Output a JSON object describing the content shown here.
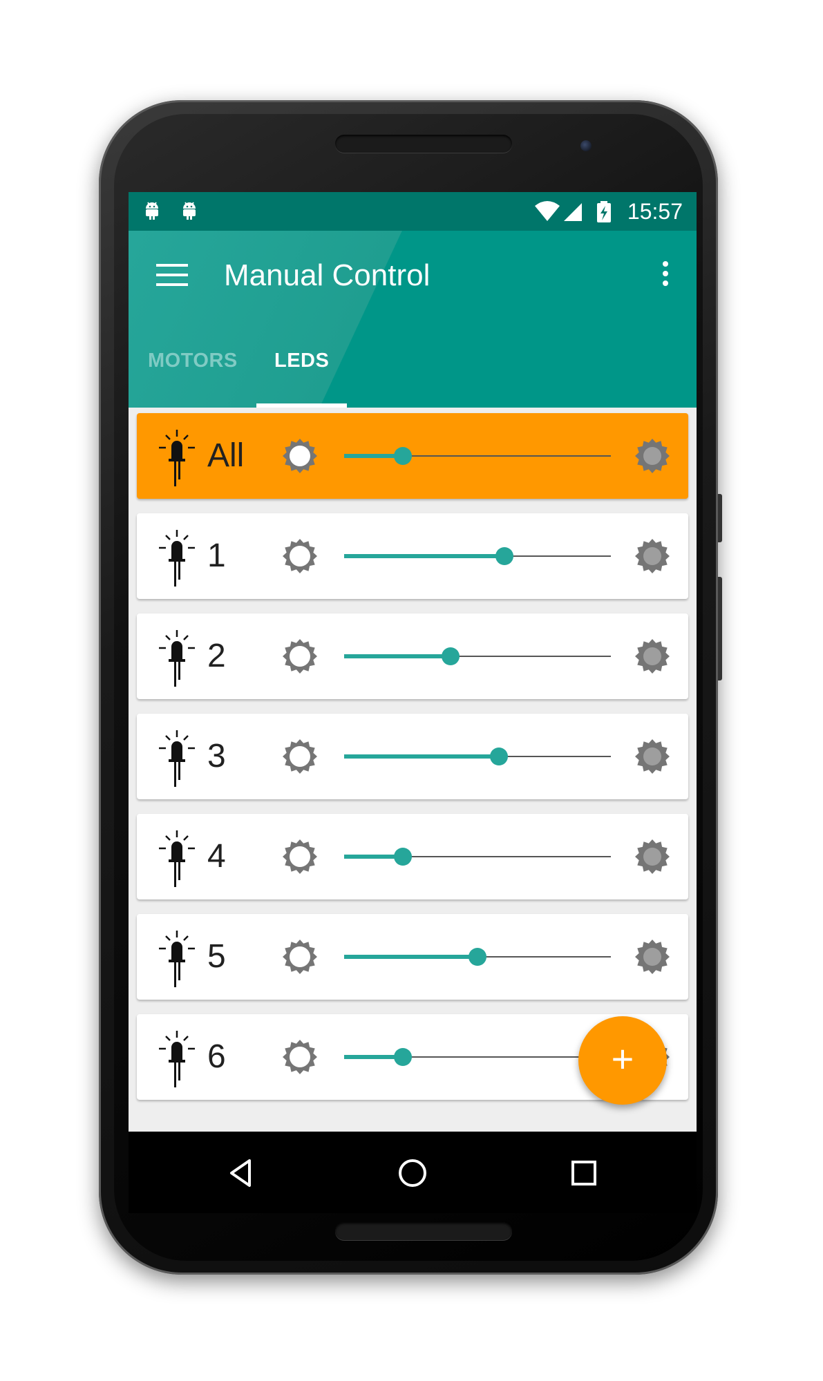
{
  "status_bar": {
    "time": "15:57",
    "notification_icons": [
      "android-debug-icon",
      "android-debug-icon"
    ],
    "system_icons": [
      "wifi-icon",
      "signal-icon",
      "battery-charging-icon"
    ]
  },
  "app_bar": {
    "title": "Manual Control",
    "menu_icon": "hamburger-menu-icon",
    "overflow_icon": "more-vert-icon"
  },
  "tabs": [
    {
      "label": "MOTORS",
      "selected": false
    },
    {
      "label": "LEDS",
      "selected": true
    }
  ],
  "leds": [
    {
      "label": "All",
      "level": 0.22,
      "highlighted": true
    },
    {
      "label": "1",
      "level": 0.6,
      "highlighted": false
    },
    {
      "label": "2",
      "level": 0.4,
      "highlighted": false
    },
    {
      "label": "3",
      "level": 0.58,
      "highlighted": false
    },
    {
      "label": "4",
      "level": 0.22,
      "highlighted": false
    },
    {
      "label": "5",
      "level": 0.5,
      "highlighted": false
    },
    {
      "label": "6",
      "level": 0.22,
      "highlighted": false
    }
  ],
  "fab": {
    "symbol": "+"
  },
  "nav_bar": [
    "back-icon",
    "home-icon",
    "recents-icon"
  ],
  "colors": {
    "primary": "#009688",
    "primary_dark": "#00766a",
    "accent": "#ff9800",
    "slider": "#26a69a"
  }
}
